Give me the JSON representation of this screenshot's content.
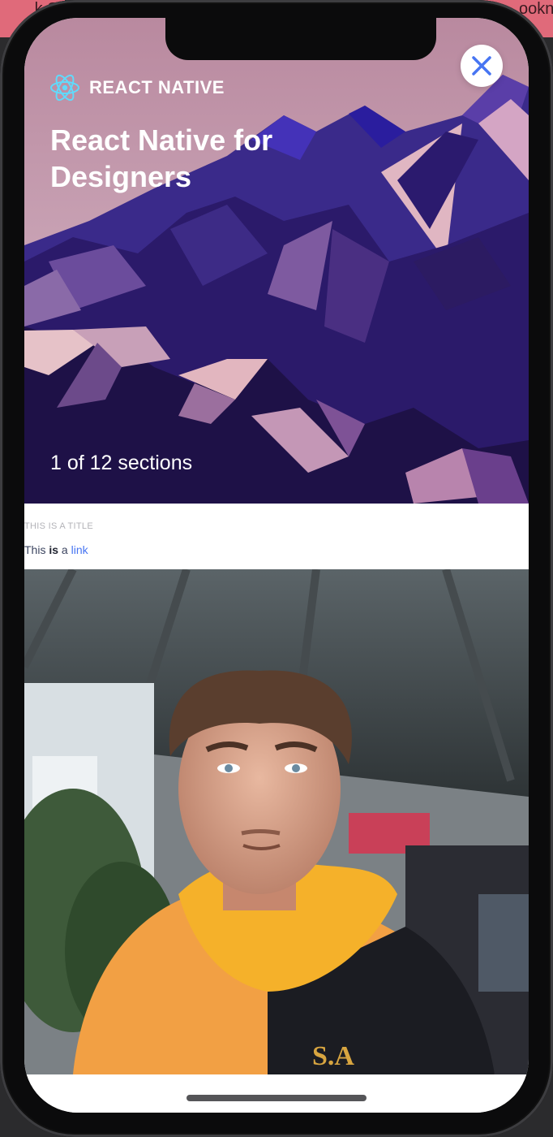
{
  "background_tabs": {
    "left": "k Si",
    "right": "ookn"
  },
  "course": {
    "brand_name": "REACT NATIVE",
    "title": "React Native for Designers",
    "subtitle": "1 of 12 sections"
  },
  "close_button": {
    "icon": "close-icon",
    "color": "#4775f2"
  },
  "content": {
    "title": "This is a title",
    "text_before": "This ",
    "text_bold": "is",
    "text_middle": " a ",
    "link_text": "link"
  },
  "colors": {
    "accent": "#4775f2",
    "hero_bg_top": "#c59eb6",
    "hero_bg_bottom": "#1e1147"
  }
}
